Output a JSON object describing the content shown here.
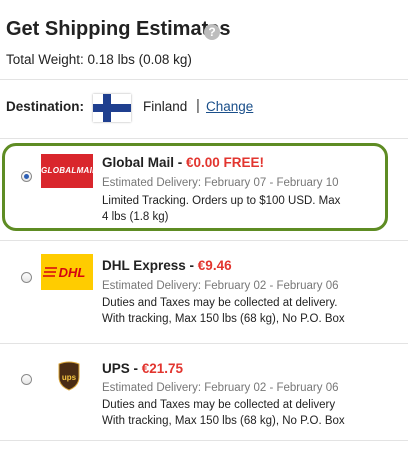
{
  "header": {
    "title": "Get Shipping Estimates",
    "help_icon_text": "?",
    "total_weight": "Total Weight: 0.18 lbs (0.08 kg)"
  },
  "destination": {
    "label": "Destination:",
    "flag_icon": "finland-flag-icon",
    "country": "Finland",
    "separator": "|",
    "change_link": "Change"
  },
  "options": [
    {
      "selected": true,
      "logo_text": "GLOBALMAIL",
      "name": "Global Mail",
      "dash": " - ",
      "price": "€0.00 FREE!",
      "estimate": "Estimated Delivery: February 07 - February 10",
      "desc_line1": "Limited Tracking. Orders up to $100 USD. Max",
      "desc_line2": "4 lbs (1.8 kg)"
    },
    {
      "selected": false,
      "logo_text": "DHL",
      "name": "DHL Express",
      "dash": " - ",
      "price": "€9.46",
      "estimate": "Estimated Delivery: February 02 - February 06",
      "desc_line1": "Duties and Taxes may be collected at delivery.",
      "desc_line2": "With tracking, Max 150 lbs (68 kg), No P.O. Box"
    },
    {
      "selected": false,
      "logo_text": "ups",
      "name": "UPS",
      "dash": " - ",
      "price": "€21.75",
      "estimate": "Estimated Delivery: February 02 - February 06",
      "desc_line1": "Duties and Taxes may be collected at delivery",
      "desc_line2": "With tracking, Max 150 lbs (68 kg), No P.O. Box"
    }
  ],
  "colors": {
    "price_red": "#e2352f",
    "selected_border_green": "#5e8c23",
    "link_blue": "#1a4f8a"
  }
}
